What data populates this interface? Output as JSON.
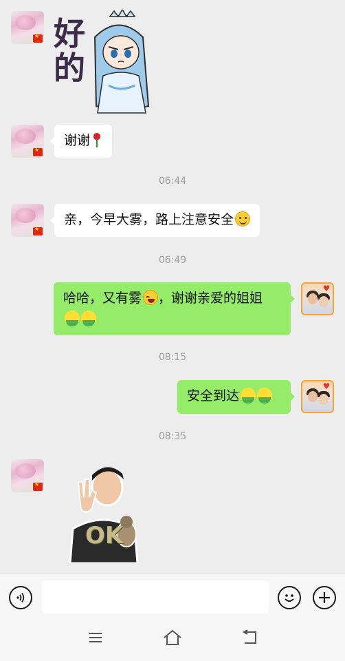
{
  "messages": [
    {
      "id": "m1",
      "side": "in",
      "kind": "sticker",
      "sticker": "princess-good-sticker",
      "sticker_text": "好的"
    },
    {
      "id": "m2",
      "side": "in",
      "kind": "text",
      "text": "谢谢",
      "emoji": [
        "rose-icon"
      ]
    },
    {
      "id": "m3",
      "side": "in",
      "kind": "text",
      "time": "06:44",
      "text": "亲，今早大雾，路上注意安全",
      "emoji": [
        "smile-icon"
      ]
    },
    {
      "id": "m4",
      "side": "out",
      "kind": "text",
      "time": "06:49",
      "text": "哈哈，又有雾",
      "text2": "，谢谢亲爱的姐姐",
      "emoji": [
        "laugh-icon",
        "chick-icon",
        "chick-icon"
      ]
    },
    {
      "id": "m5",
      "side": "out",
      "kind": "text",
      "time": "08:15",
      "text": "安全到达",
      "emoji": [
        "chick-icon",
        "chick-icon"
      ]
    },
    {
      "id": "m6",
      "side": "in",
      "kind": "sticker",
      "time": "08:35",
      "sticker": "ok-gesture-sticker",
      "sticker_text": "OK"
    }
  ],
  "times": {
    "t1": "06:44",
    "t2": "06:49",
    "t3": "08:15",
    "t4": "08:35"
  },
  "texts": {
    "thanks": "谢谢",
    "fog_warning": "亲，今早大雾，路上注意安全",
    "reply_part1": "哈哈，又有雾",
    "reply_part2": "，谢谢亲爱的姐姐",
    "arrived": "安全到达",
    "sticker_good": "好的",
    "sticker_ok": "OK"
  },
  "composer": {
    "input_value": "",
    "voice_icon": "voice-icon",
    "emoji_icon": "emoji-icon",
    "plus_icon": "plus-icon"
  },
  "colors": {
    "background": "#ededed",
    "bubble_in": "#ffffff",
    "bubble_out": "#95ec69",
    "time_text": "#9e9e9e"
  },
  "navbar": {
    "menu_icon": "menu-icon",
    "home_icon": "home-icon",
    "back_icon": "back-icon"
  }
}
